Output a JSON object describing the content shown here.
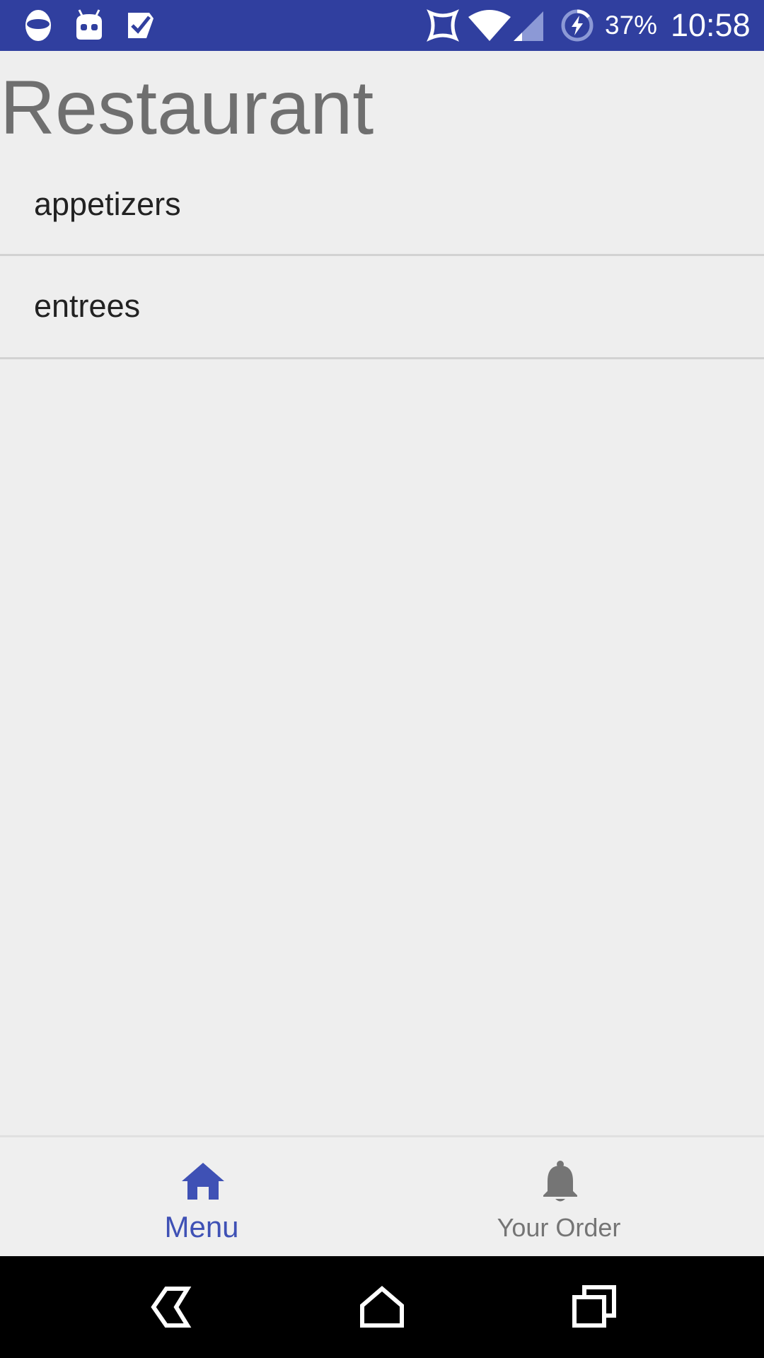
{
  "status_bar": {
    "battery_percent": "37%",
    "time": "10:58",
    "color": "#303f9f",
    "icons": [
      "cyanogen-icon",
      "android-debug-icon",
      "task-check-icon",
      "nfc-icon",
      "wifi-icon",
      "signal-icon",
      "battery-charging-icon"
    ]
  },
  "header": {
    "title": "Restaurant"
  },
  "categories": [
    {
      "label": "appetizers"
    },
    {
      "label": "entrees"
    }
  ],
  "bottom_nav": {
    "items": [
      {
        "label": "Menu",
        "icon": "home-icon",
        "active": true,
        "color": "#3f51b5"
      },
      {
        "label": "Your Order",
        "icon": "bell-icon",
        "active": false,
        "color": "#757575"
      }
    ]
  },
  "system_nav": {
    "buttons": [
      "back-icon",
      "home-outline-icon",
      "recents-icon"
    ]
  }
}
